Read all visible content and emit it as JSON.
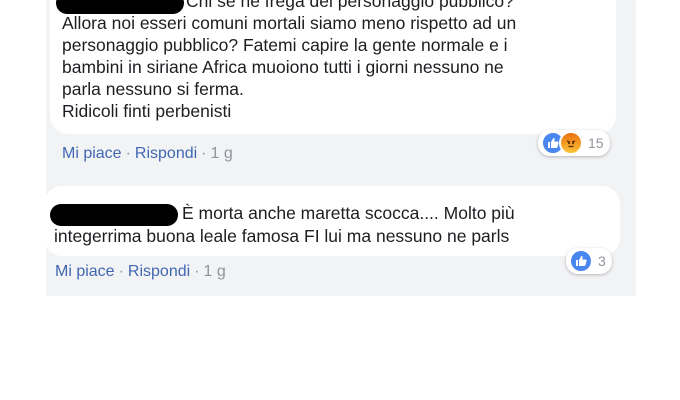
{
  "comment1": {
    "lines": [
      "Chi se ne frega del personaggio pubblico?",
      "Allora noi esseri comuni mortali siamo meno rispetto ad un",
      "personaggio pubblico? Fatemi capire la gente normale e i",
      "bambini in siriane Africa muoiono tutti i giorni nessuno ne",
      "parla nessuno si ferma.",
      "Ridicoli finti perbenisti"
    ],
    "actions": {
      "like": "Mi piace",
      "reply": "Rispondi",
      "time": "1 g"
    },
    "reactions": {
      "icons": [
        "like-icon",
        "angry-icon"
      ],
      "count": "15"
    }
  },
  "comment2": {
    "lines": [
      "È morta anche maretta scocca.... Molto più",
      "integerrima buona leale famosa FI lui ma nessuno ne parls"
    ],
    "actions": {
      "like": "Mi piace",
      "reply": "Rispondi",
      "time": "1 g"
    },
    "reactions": {
      "icons": [
        "like-icon"
      ],
      "count": "3"
    }
  },
  "colors": {
    "link": "#4267b2",
    "text": "#1c1e21",
    "meta": "#90949c",
    "panel": "#f2f3f5",
    "like": "#4a86f0"
  }
}
